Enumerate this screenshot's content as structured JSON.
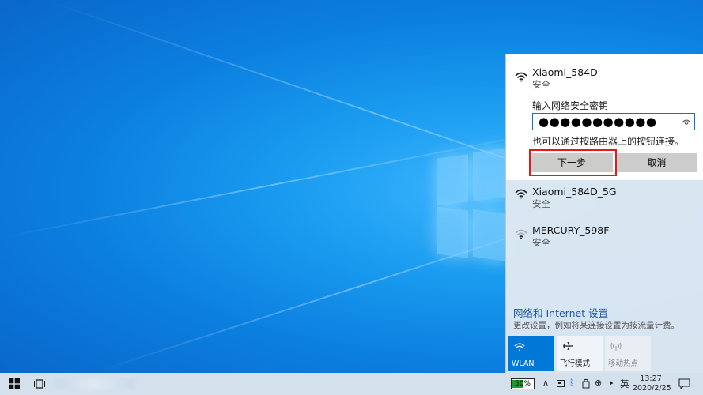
{
  "networks": {
    "active": {
      "name": "Xiaomi_584D",
      "security": "安全",
      "key_prompt": "输入网络安全密钥",
      "password_mask": "●●●●●●●●●●●",
      "alt_connect": "也可以通过按路由器上的按钮连接。",
      "next_label": "下一步",
      "cancel_label": "取消"
    },
    "others": [
      {
        "name": "Xiaomi_584D_5G",
        "security": "安全"
      },
      {
        "name": "MERCURY_598F",
        "security": "安全"
      }
    ]
  },
  "settings": {
    "title": "网络和 Internet 设置",
    "subtitle": "更改设置，例如将某连接设置为按流量计费。"
  },
  "quick_actions": [
    {
      "label": "WLAN",
      "icon": "wifi-icon",
      "active": true
    },
    {
      "label": "飞行模式",
      "icon": "airplane-icon",
      "active": false
    },
    {
      "label": "移动热点",
      "icon": "hotspot-icon",
      "active": false
    }
  ],
  "taskbar": {
    "battery": "50%",
    "ime": "英",
    "time": "13:27",
    "date": "2020/2/25"
  },
  "colors": {
    "accent": "#0078d7",
    "highlight": "#e21a1a",
    "link": "#1b5aa8"
  }
}
